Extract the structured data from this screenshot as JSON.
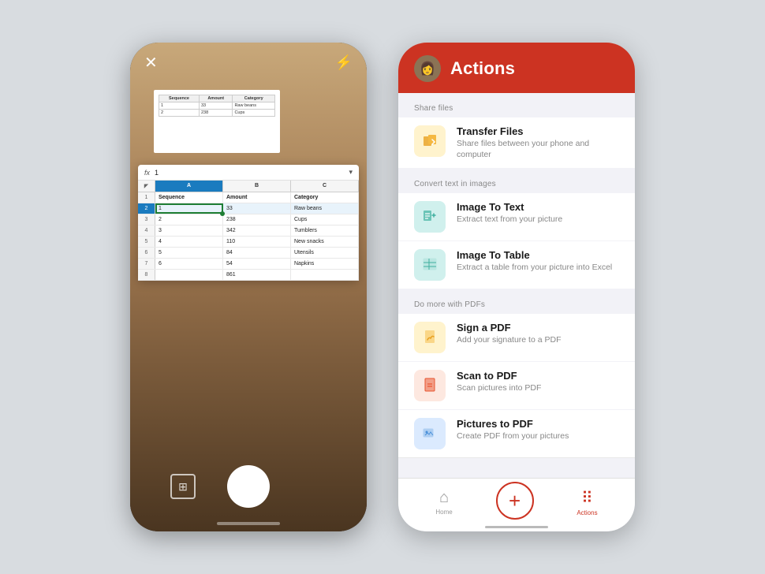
{
  "left_phone": {
    "formula_bar": {
      "label": "fx",
      "value": "1",
      "chevron": "▾"
    },
    "spreadsheet": {
      "columns": [
        "A",
        "B",
        "C"
      ],
      "col_headers": [
        "",
        "A",
        "B",
        "C"
      ],
      "rows": [
        {
          "num": "1",
          "a": "Sequence",
          "b": "Amount",
          "c": "Category",
          "header": true
        },
        {
          "num": "2",
          "a": "1",
          "b": "33",
          "c": "Raw beans",
          "selected": true
        },
        {
          "num": "3",
          "a": "2",
          "b": "238",
          "c": "Cups"
        },
        {
          "num": "4",
          "a": "3",
          "b": "342",
          "c": "Tumblers"
        },
        {
          "num": "5",
          "a": "4",
          "b": "110",
          "c": "New snacks"
        },
        {
          "num": "6",
          "a": "5",
          "b": "84",
          "c": "Utensils"
        },
        {
          "num": "7",
          "a": "6",
          "b": "54",
          "c": "Napkins"
        },
        {
          "num": "8",
          "a": "",
          "b": "861",
          "c": ""
        }
      ]
    },
    "paper_table": {
      "headers": [
        "Sequence",
        "Amount",
        "Category"
      ],
      "rows": [
        [
          "1",
          "33",
          "Raw beans"
        ],
        [
          "2",
          "238",
          "Cups"
        ]
      ]
    }
  },
  "right_phone": {
    "header": {
      "title": "Actions"
    },
    "sections": [
      {
        "label": "Share files",
        "items": [
          {
            "id": "transfer-files",
            "title": "Transfer Files",
            "description": "Share files between your phone and computer",
            "icon_color": "yellow",
            "icon": "📁"
          }
        ]
      },
      {
        "label": "Convert text in images",
        "items": [
          {
            "id": "image-to-text",
            "title": "Image To Text",
            "description": "Extract text from your picture",
            "icon_color": "teal",
            "icon": "🖼"
          },
          {
            "id": "image-to-table",
            "title": "Image To Table",
            "description": "Extract a table from your picture into Excel",
            "icon_color": "teal",
            "icon": "📊"
          }
        ]
      },
      {
        "label": "Do more with PDFs",
        "items": [
          {
            "id": "sign-pdf",
            "title": "Sign a PDF",
            "description": "Add your signature to a PDF",
            "icon_color": "yellow",
            "icon": "✍"
          },
          {
            "id": "scan-to-pdf",
            "title": "Scan to PDF",
            "description": "Scan pictures into PDF",
            "icon_color": "orange-red",
            "icon": "📄"
          },
          {
            "id": "pictures-to-pdf",
            "title": "Pictures to PDF",
            "description": "Create PDF from your pictures",
            "icon_color": "blue",
            "icon": "🖼"
          }
        ]
      }
    ],
    "bottom_nav": {
      "items": [
        {
          "id": "home",
          "label": "Home",
          "icon": "⌂",
          "active": false
        },
        {
          "id": "plus",
          "label": "+",
          "active": false
        },
        {
          "id": "actions",
          "label": "Actions",
          "icon": "⠿",
          "active": true
        }
      ]
    }
  }
}
